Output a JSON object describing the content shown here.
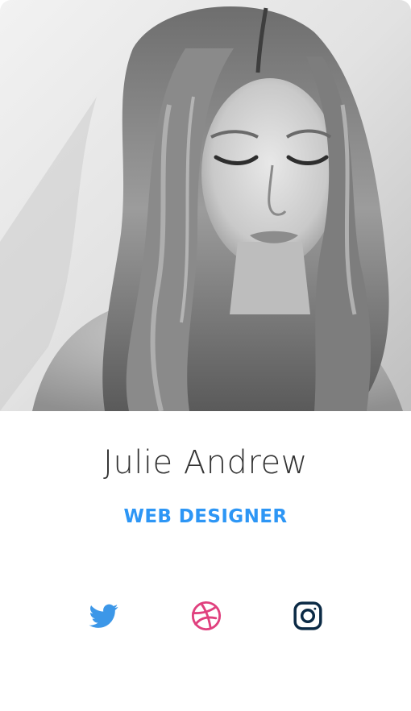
{
  "profile": {
    "name": "Julie Andrew",
    "role": "WEB DESIGNER",
    "photo_alt": "portrait"
  },
  "theme": {
    "role_color": "#2D96F5",
    "twitter_color": "#3C97E8",
    "dribbble_color": "#E0407E",
    "instagram_color": "#0B2A45"
  },
  "social": [
    {
      "network": "twitter",
      "icon": "twitter-bird-icon"
    },
    {
      "network": "dribbble",
      "icon": "dribbble-ball-icon"
    },
    {
      "network": "instagram",
      "icon": "instagram-camera-icon"
    }
  ]
}
